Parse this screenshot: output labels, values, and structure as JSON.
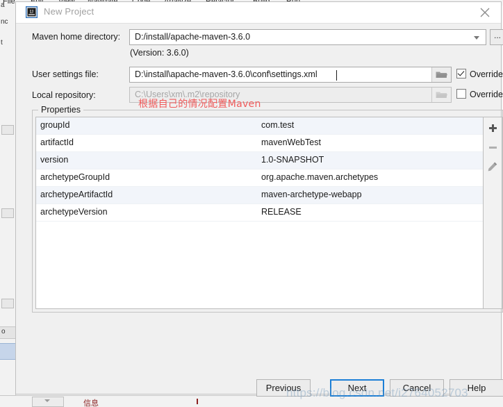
{
  "background": {
    "menu_items": [
      "File",
      "Edit",
      "View",
      "Navigate",
      "Code",
      "Analyze",
      "Refactor",
      "Build",
      "Run"
    ],
    "left_strip_labels": [
      "a",
      "nc",
      "t",
      "o"
    ],
    "status_label": "信息",
    "colors": {
      "chrome": "#f2f2f2",
      "selection": "#c6d5ea",
      "text": "#2b2b2b"
    }
  },
  "dialog": {
    "title": "New Project",
    "icon": "intellij-idea-icon",
    "close_icon": "close-icon",
    "accent": "#1c7fd6",
    "background": "#f0f0f0"
  },
  "form": {
    "maven_home": {
      "label": "Maven home directory:",
      "value": "D:/install/apache-maven-3.6.0",
      "caret_icon": "chevron-down-icon",
      "browse_label": "...",
      "version_note": "(Version: 3.6.0)"
    },
    "user_settings": {
      "label": "User settings file:",
      "value": "D:\\install\\apache-maven-3.6.0\\conf\\settings.xml",
      "folder_icon": "folder-icon",
      "override_label": "Override",
      "override_checked": true
    },
    "local_repository": {
      "label": "Local repository:",
      "value": "C:\\Users\\xm\\.m2\\repository",
      "folder_icon": "folder-icon",
      "override_label": "Override",
      "override_checked": false,
      "disabled": true
    }
  },
  "annotation": {
    "text": "根据自己的情况配置Maven",
    "color": "#f05a5a"
  },
  "properties": {
    "group_title": "Properties",
    "rows": [
      {
        "key": "groupId",
        "value": "com.test"
      },
      {
        "key": "artifactId",
        "value": "mavenWebTest"
      },
      {
        "key": "version",
        "value": "1.0-SNAPSHOT"
      },
      {
        "key": "archetypeGroupId",
        "value": "org.apache.maven.archetypes"
      },
      {
        "key": "archetypeArtifactId",
        "value": "maven-archetype-webapp"
      },
      {
        "key": "archetypeVersion",
        "value": "RELEASE"
      }
    ],
    "toolbar": [
      {
        "name": "add-property-button",
        "icon": "plus-icon"
      },
      {
        "name": "remove-property-button",
        "icon": "minus-icon"
      },
      {
        "name": "edit-property-button",
        "icon": "pencil-icon"
      }
    ]
  },
  "footer": {
    "previous_label": "Previous",
    "next_label": "Next",
    "cancel_label": "Cancel",
    "help_label": "Help",
    "focused_button": "Next"
  },
  "watermark": {
    "text": "https://blog.csdn.net/i2764052703"
  }
}
